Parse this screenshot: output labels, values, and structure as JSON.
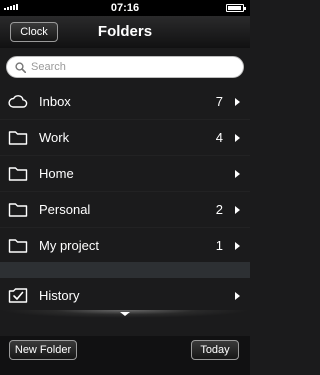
{
  "status_bar": {
    "time": "07:16"
  },
  "nav": {
    "title": "Folders",
    "left_button": "Clock"
  },
  "search": {
    "placeholder": "Search"
  },
  "folders": [
    {
      "label": "Inbox",
      "count": "7",
      "icon": "cloud-icon"
    },
    {
      "label": "Work",
      "count": "4",
      "icon": "folder-icon"
    },
    {
      "label": "Home",
      "count": "",
      "icon": "folder-icon"
    },
    {
      "label": "Personal",
      "count": "2",
      "icon": "folder-icon"
    },
    {
      "label": "My project",
      "count": "1",
      "icon": "folder-icon"
    }
  ],
  "history": {
    "label": "History",
    "icon": "checkbox-icon"
  },
  "toolbar": {
    "new_folder": "New Folder",
    "today": "Today"
  },
  "colors": {
    "background": "#1b1b1c",
    "separator": "#2d3033",
    "text": "#ffffff"
  }
}
